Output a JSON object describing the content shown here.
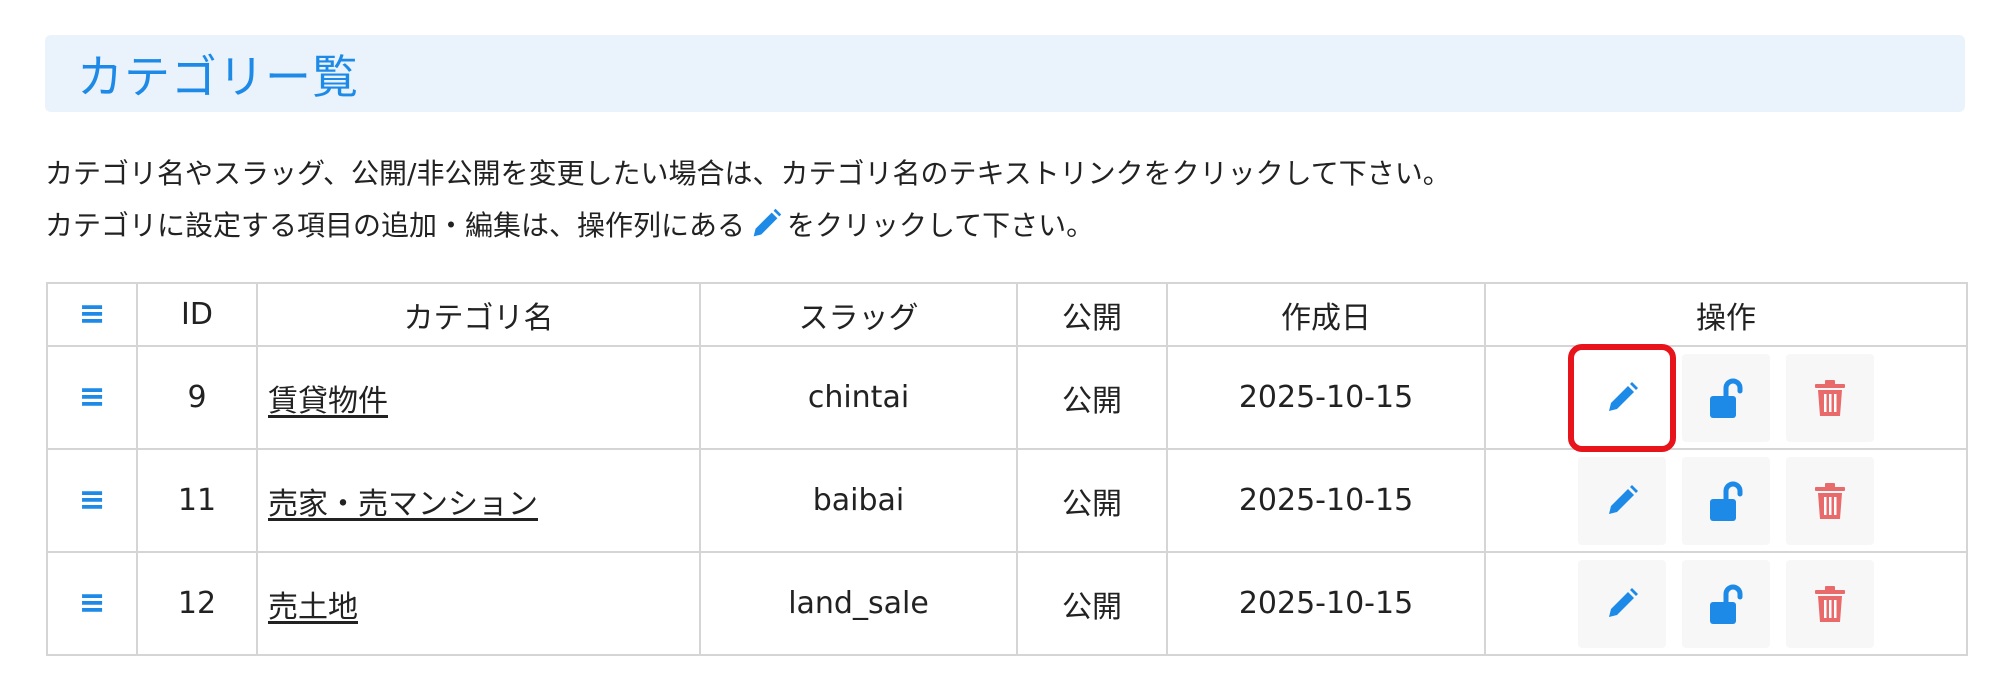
{
  "header": {
    "title": "カテゴリー覧"
  },
  "description": {
    "line1": "カテゴリ名やスラッグ、公開/非公開を変更したい場合は、カテゴリ名のテキストリンクをクリックして下さい。",
    "line2_before": "カテゴリに設定する項目の追加・編集は、操作列にある",
    "line2_icon": "pencil-icon",
    "line2_after": "をクリックして下さい。"
  },
  "table": {
    "headers": {
      "drag": "≡",
      "id": "ID",
      "name": "カテゴリ名",
      "slug": "スラッグ",
      "status": "公開",
      "created": "作成日",
      "actions": "操作"
    },
    "rows": [
      {
        "id": "9",
        "name": "賃貸物件",
        "slug": "chintai",
        "status": "公開",
        "created": "2025-10-15"
      },
      {
        "id": "11",
        "name": "売家・売マンション",
        "slug": "baibai",
        "status": "公開",
        "created": "2025-10-15"
      },
      {
        "id": "12",
        "name": "売土地",
        "slug": "land_sale",
        "status": "公開",
        "created": "2025-10-15"
      }
    ],
    "row_drag_glyph": "≡",
    "action_icons": [
      "pencil-icon",
      "unlock-icon",
      "trash-icon"
    ],
    "highlighted_action": "row 1 edit (pencil) button"
  },
  "colors": {
    "accent": "#1d8ae8",
    "title_bg": "#eaf3fb",
    "delete": "#e96a6a",
    "highlight_border": "#e8141c",
    "grid": "#d5d5d5"
  }
}
